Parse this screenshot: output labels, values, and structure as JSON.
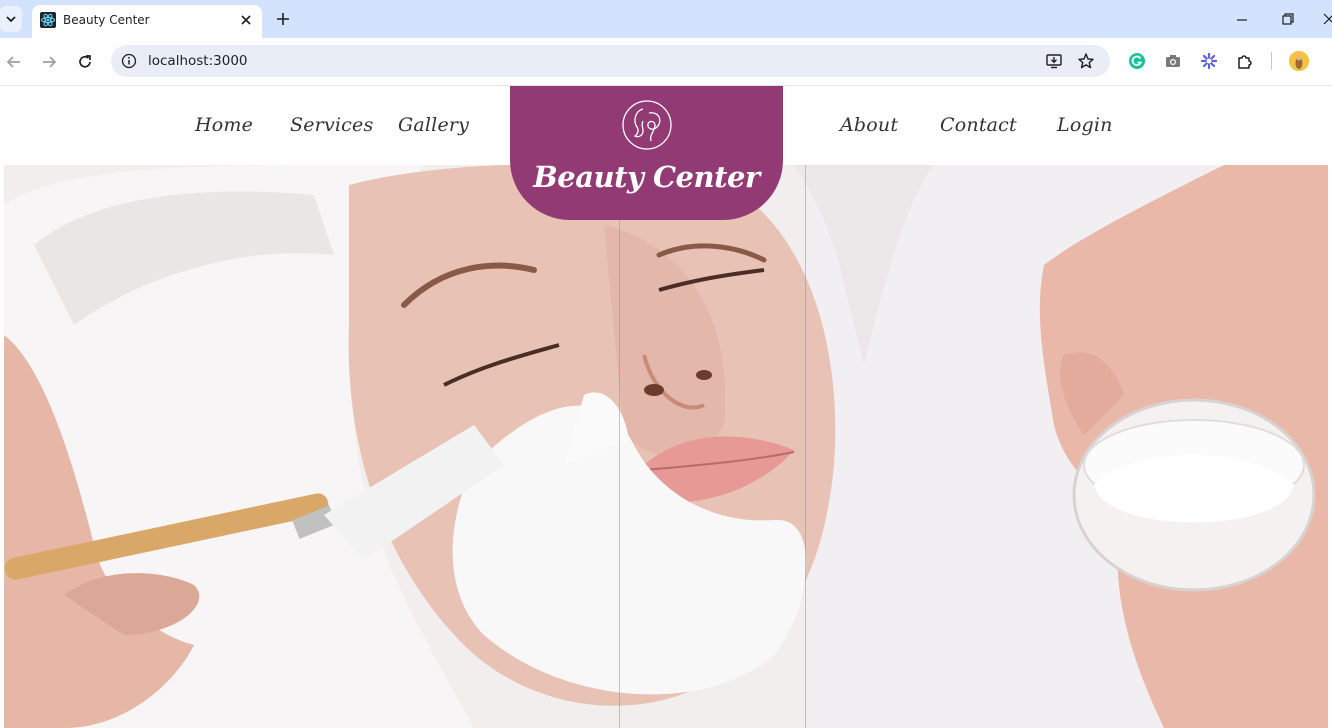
{
  "browser": {
    "tab": {
      "title": "Beauty Center"
    },
    "address_bar": {
      "url": "localhost:3000"
    }
  },
  "site": {
    "logo_text": "Beauty Center",
    "nav_left": [
      "Home",
      "Services",
      "Gallery"
    ],
    "nav_right": [
      "About",
      "Contact",
      "Login"
    ],
    "brand_color": "#923a73"
  },
  "hero": {
    "image_description_icon": "facial-treatment-photo"
  }
}
